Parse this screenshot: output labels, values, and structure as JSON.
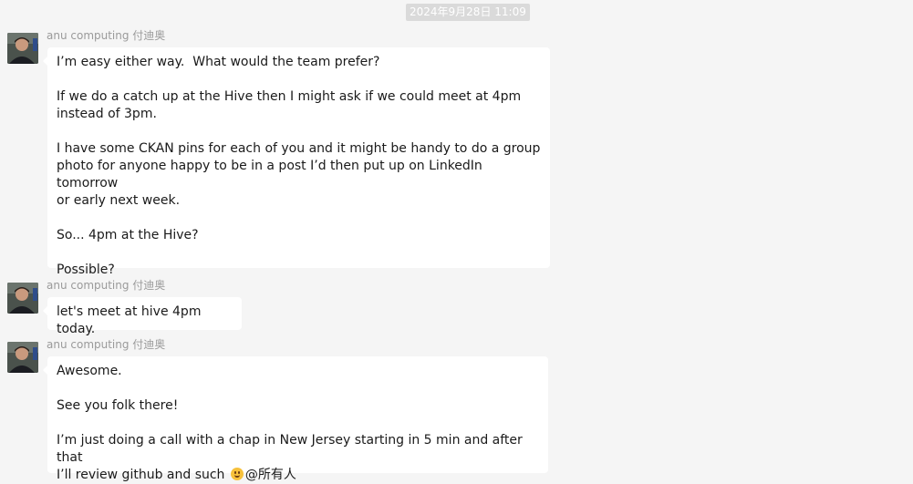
{
  "timestamp": "2024年9月28日 11:09",
  "messages": [
    {
      "sender": "anu computing 付迪奥",
      "paragraphs": [
        "I’m easy either way.  What would the team prefer?",
        "If we do a catch up at the Hive then I might ask if we could meet at 4pm\ninstead of 3pm.",
        "I have some CKAN pins for each of you and it might be handy to do a group\nphoto for anyone happy to be in a post I’d then put up on LinkedIn tomorrow\nor early next week.",
        "So... 4pm at the Hive?",
        "Possible?"
      ]
    },
    {
      "sender": "anu computing 付迪奥",
      "paragraphs": [
        "let's meet at hive 4pm today."
      ]
    },
    {
      "sender": "anu computing 付迪奥",
      "paragraphs": [
        "Awesome.",
        "See you folk there!",
        "I’m just doing a call with a chap in New Jersey starting in 5 min and after that\nI’ll review github and such"
      ],
      "emoji": "smile-emoji",
      "mention": "@所有人"
    }
  ]
}
